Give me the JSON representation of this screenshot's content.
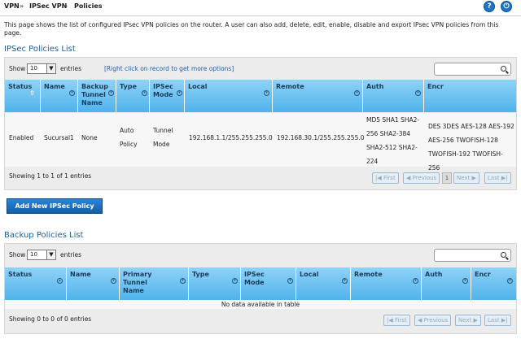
{
  "breadcrumb": {
    "items": [
      "VPN",
      "IPSec VPN",
      "Policies"
    ],
    "separator": "»"
  },
  "header_icons": {
    "help": "?",
    "logout": "⏻"
  },
  "description": "This page shows the list of configured IPsec VPN policies on the router. A user can also add, delete, edit, enable, disable and export IPsec VPN policies from this page.",
  "ipsec": {
    "title": "IPSec Policies List",
    "show_label": "Show",
    "entries_value": "10",
    "entries_label": "entries",
    "hint": "[Right click on record to get more options]",
    "search_placeholder": "",
    "columns": [
      "Status",
      "Name",
      "Backup Tunnel Name",
      "Type",
      "IPSec Mode",
      "Local",
      "Remote",
      "Auth",
      "Encr"
    ],
    "rows": [
      {
        "status": "Enabled",
        "name": "Sucursal1",
        "backup": "None",
        "type": "Auto Policy",
        "mode": "Tunnel Mode",
        "local": "192.168.1.1/255.255.255.0",
        "remote": "192.168.30.1/255.255.255.0",
        "auth": "MD5 SHA1 SHA2-256 SHA2-384 SHA2-512 SHA2-224",
        "encr": "DES 3DES AES-128 AES-192 AES-256 TWOFISH-128 TWOFISH-192 TWOFISH-256"
      }
    ],
    "info": "Showing 1 to 1 of 1 entries",
    "pager": {
      "first": "First",
      "previous": "Previous",
      "page": "1",
      "next": "Next",
      "last": "Last"
    }
  },
  "add_button": "Add New IPSec Policy",
  "backup": {
    "title": "Backup Policies List",
    "show_label": "Show",
    "entries_value": "10",
    "entries_label": "entries",
    "search_placeholder": "",
    "columns": [
      "Status",
      "Name",
      "Primary Tunnel Name",
      "Type",
      "IPSec Mode",
      "Local",
      "Remote",
      "Auth",
      "Encr"
    ],
    "empty": "No data available in table",
    "info": "Showing 0 to 0 of 0 entries",
    "pager": {
      "first": "First",
      "previous": "Previous",
      "next": "Next",
      "last": "Last"
    }
  }
}
